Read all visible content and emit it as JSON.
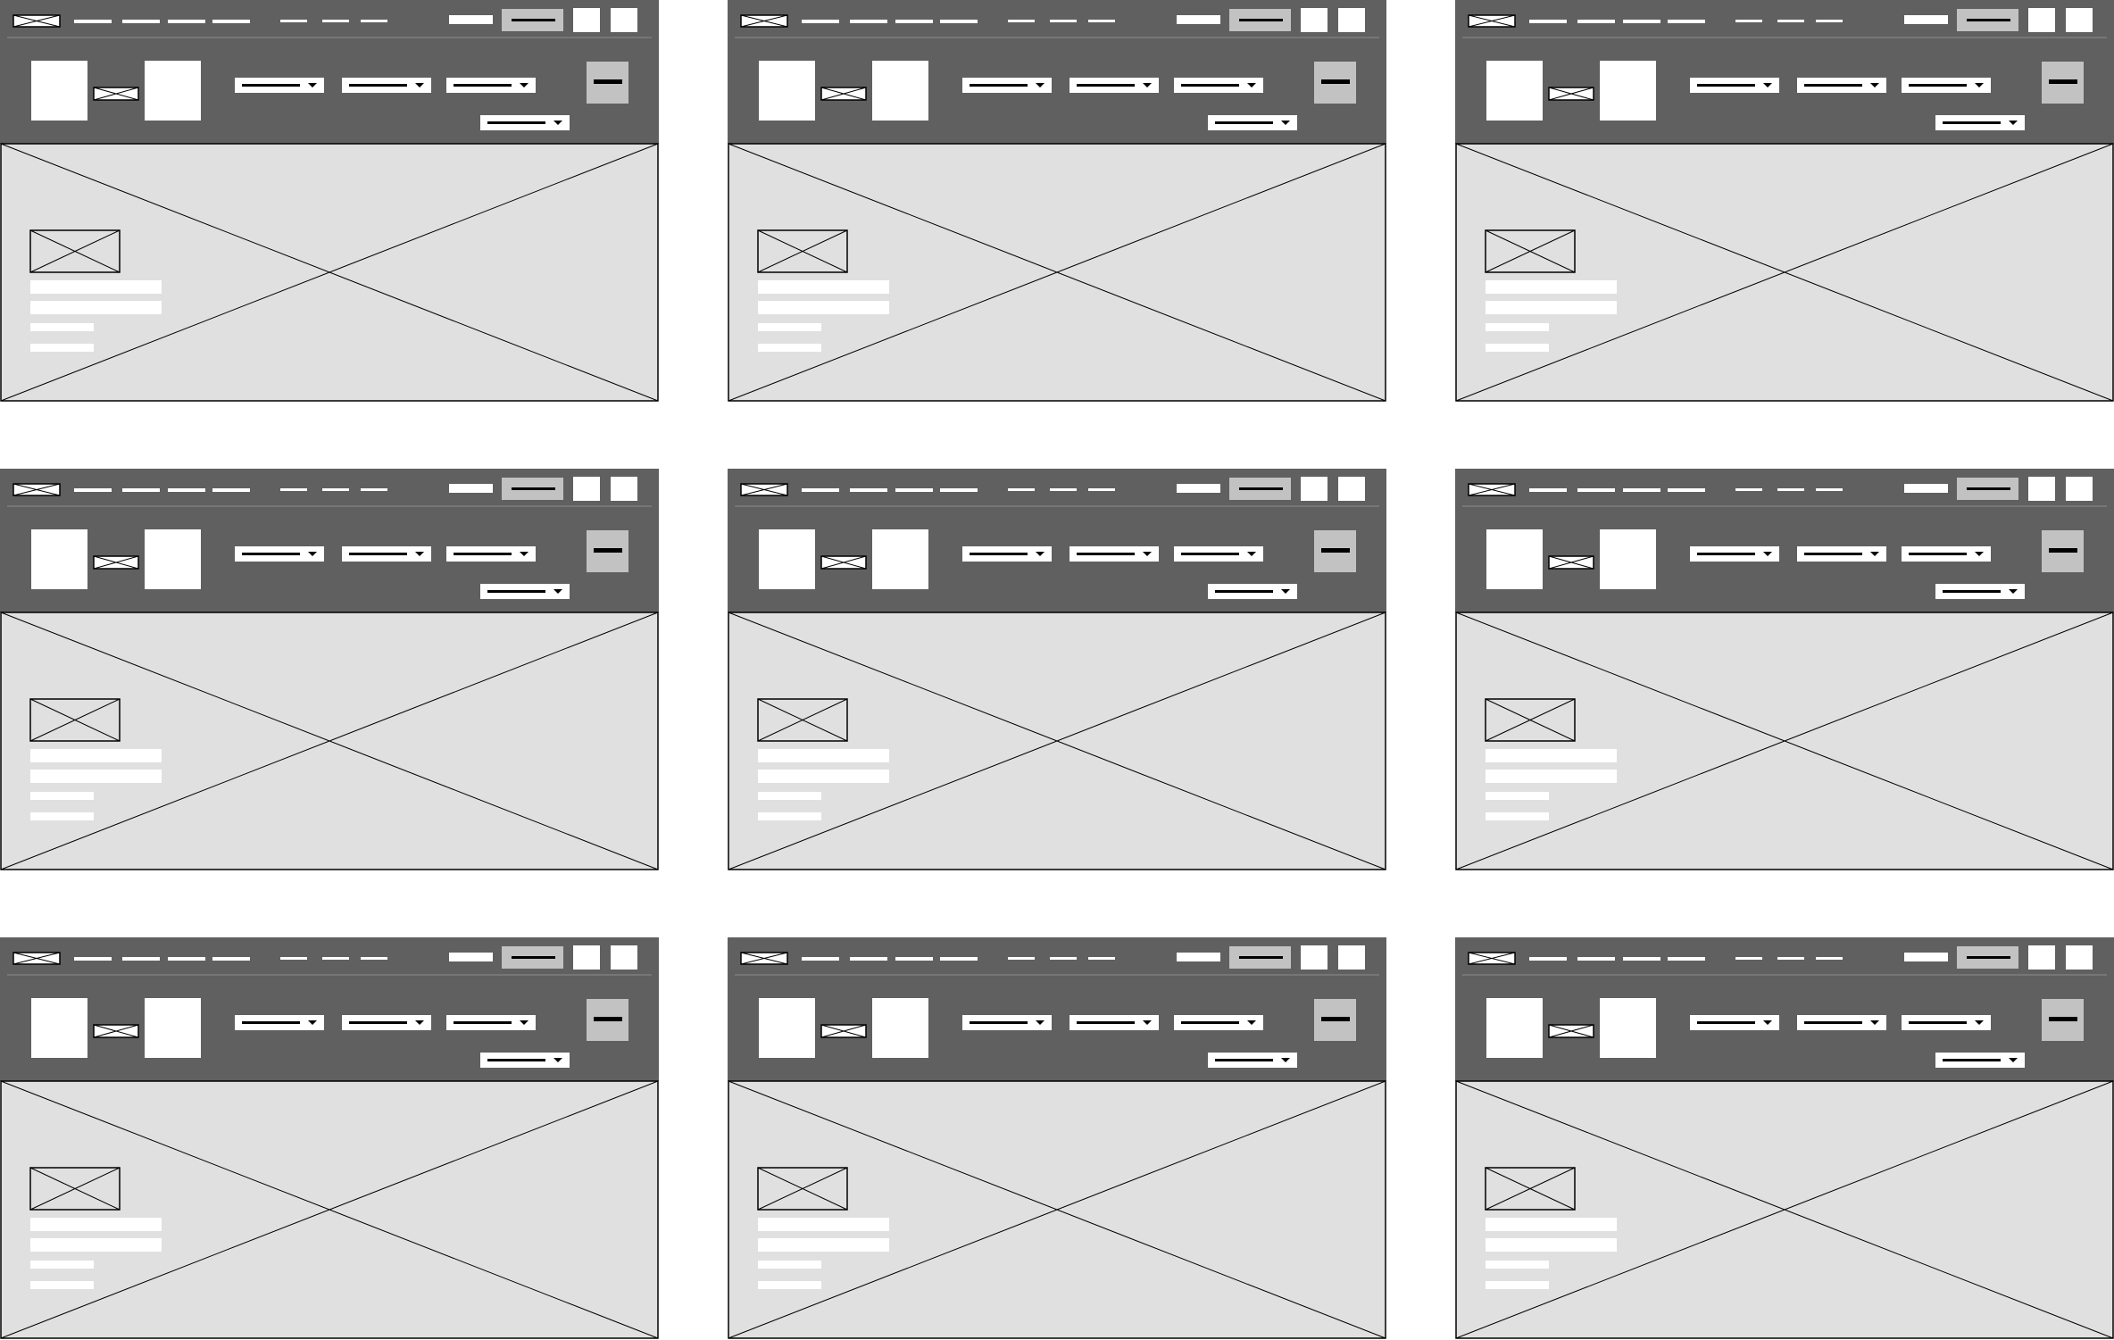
{
  "page": {
    "background": "#ffffff",
    "columns": 3,
    "rows": 3
  },
  "colors": {
    "header": "#606060",
    "header_divider": "#8c8c8c",
    "hero": "#e0e0e0",
    "selected_button": "#c2c2c2",
    "block": "#ffffff",
    "line": "#000000"
  },
  "icons": {
    "logo": "placeholder-image-icon",
    "brand_image": "placeholder-image-icon",
    "dropdown": "caret-down-icon",
    "hero_image": "placeholder-image-icon"
  },
  "wireframes": [
    {
      "id": "wireframe-1"
    },
    {
      "id": "wireframe-2"
    },
    {
      "id": "wireframe-3"
    },
    {
      "id": "wireframe-4"
    },
    {
      "id": "wireframe-5"
    },
    {
      "id": "wireframe-6"
    },
    {
      "id": "wireframe-7"
    },
    {
      "id": "wireframe-8"
    },
    {
      "id": "wireframe-9"
    }
  ],
  "wireframe_template": {
    "nav_links_primary": 4,
    "nav_links_secondary": 3,
    "action_icon_boxes": 2,
    "dropdowns": 4,
    "hero_text_bars": 4
  }
}
